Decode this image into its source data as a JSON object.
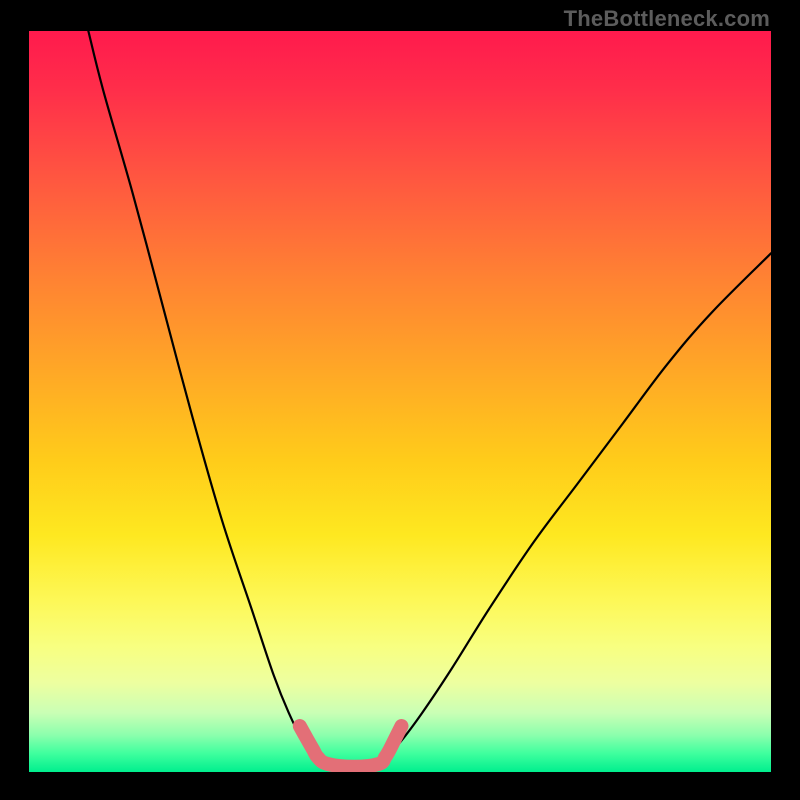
{
  "watermark": "TheBottleneck.com",
  "chart_data": {
    "type": "line",
    "title": "",
    "xlabel": "",
    "ylabel": "",
    "xlim": [
      0,
      100
    ],
    "ylim": [
      0,
      100
    ],
    "series": [
      {
        "name": "bottleneck-curve-left",
        "x": [
          8,
          10,
          14,
          18,
          22,
          26,
          30,
          33,
          35,
          37,
          38.5
        ],
        "values": [
          100,
          92,
          78,
          63,
          48,
          34,
          22,
          13,
          8,
          4,
          2
        ]
      },
      {
        "name": "bottleneck-curve-right",
        "x": [
          48,
          50,
          53,
          57,
          62,
          68,
          74,
          80,
          86,
          92,
          100
        ],
        "values": [
          2,
          4,
          8,
          14,
          22,
          31,
          39,
          47,
          55,
          62,
          70
        ]
      },
      {
        "name": "optimal-zone-marker",
        "x": [
          36.5,
          37.5,
          38.3,
          38.9,
          40.2,
          43.8,
          47.2,
          48.0,
          48.6,
          49.3,
          50.2
        ],
        "values": [
          6.2,
          4.4,
          3.0,
          2.0,
          1.1,
          0.7,
          1.1,
          2.0,
          3.0,
          4.4,
          6.2
        ]
      }
    ],
    "annotations": []
  }
}
